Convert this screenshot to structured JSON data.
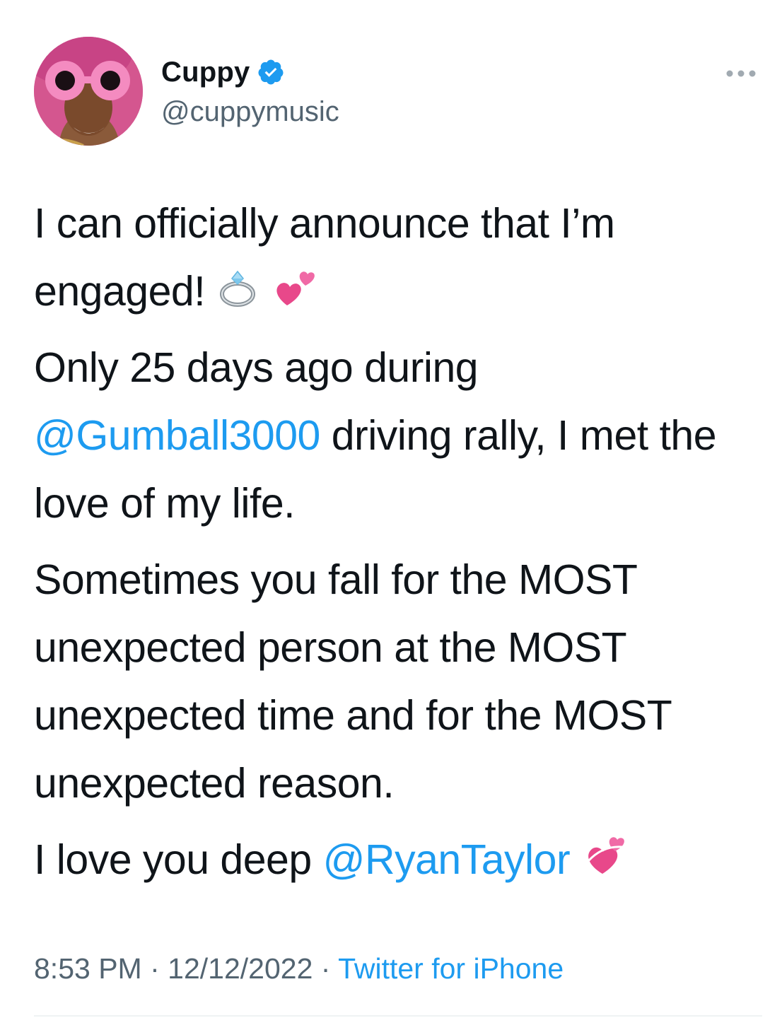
{
  "tweet": {
    "author": {
      "display_name": "Cuppy",
      "handle": "@cuppymusic",
      "verified": true,
      "avatar_icon": "avatar-pink-goggles"
    },
    "paragraphs": [
      {
        "text": "I can officially announce that I’m engaged!",
        "emoji": [
          "ring-icon",
          "two-hearts-icon"
        ]
      },
      {
        "text_before": "Only 25 days ago during ",
        "mention": "@Gumball3000",
        "text_after": " driving rally, I met the love of my life."
      },
      {
        "text": "Sometimes you fall for the MOST unexpected person at the MOST unexpected time and for the MOST unexpected reason."
      },
      {
        "text_before": "I love you deep ",
        "mention": "@RyanTaylor",
        "emoji": [
          "revolving-hearts-icon"
        ]
      }
    ],
    "time": "8:53 PM",
    "separator": "·",
    "date": "12/12/2022",
    "source": "Twitter for iPhone"
  },
  "colors": {
    "link": "#1d9bf0",
    "text": "#0f1419",
    "secondary": "#536471",
    "verified": "#1d9bf0"
  }
}
